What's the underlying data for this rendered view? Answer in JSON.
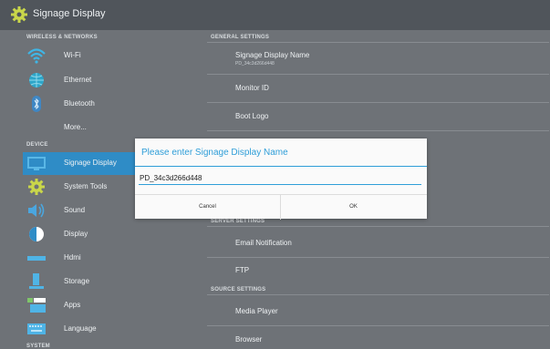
{
  "app": {
    "title": "Signage Display",
    "icon": "gear-icon"
  },
  "left_sections": {
    "wireless": "WIRELESS & NETWORKS",
    "device": "DEVICE",
    "system": "SYSTEM"
  },
  "left_items": [
    {
      "label": "Wi-Fi",
      "icon": "wifi-icon"
    },
    {
      "label": "Ethernet",
      "icon": "ethernet-globe-icon"
    },
    {
      "label": "Bluetooth",
      "icon": "bluetooth-icon"
    },
    {
      "label": "More...",
      "icon": ""
    },
    {
      "label": "Signage Display",
      "icon": "display-icon",
      "selected": true
    },
    {
      "label": "System Tools",
      "icon": "gear-icon"
    },
    {
      "label": "Sound",
      "icon": "speaker-icon"
    },
    {
      "label": "Display",
      "icon": "brightness-icon"
    },
    {
      "label": "Hdmi",
      "icon": "hdmi-icon"
    },
    {
      "label": "Storage",
      "icon": "storage-icon"
    },
    {
      "label": "Apps",
      "icon": "apps-icon"
    },
    {
      "label": "Language",
      "icon": "keyboard-icon"
    }
  ],
  "right_sections": {
    "general": "GENERAL SETTINGS",
    "server": "SERVER SETTINGS",
    "source": "SOURCE SETTINGS"
  },
  "right_items": {
    "signage_name": {
      "label": "Signage Display Name",
      "sub": "PD_34c3d266d448"
    },
    "monitor_id": "Monitor ID",
    "boot_logo": "Boot Logo",
    "email_notification": "Email Notification",
    "ftp": "FTP",
    "media_player": "Media Player",
    "browser": "Browser"
  },
  "dialog": {
    "title": "Please enter Signage Display Name",
    "value": "PD_34c3d266d448",
    "cancel": "Cancel",
    "ok": "OK"
  },
  "colors": {
    "accent": "#2f9ed8",
    "selected": "#2f8cc6",
    "background": "#6e7277",
    "topbar": "#50555b"
  }
}
